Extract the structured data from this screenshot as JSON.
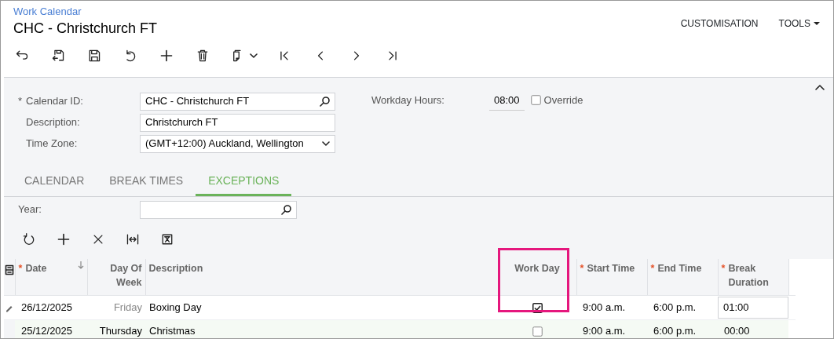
{
  "breadcrumb": "Work Calendar",
  "title": "CHC - Christchurch FT",
  "top_menu": [
    {
      "label": "CUSTOMISATION",
      "dropdown": false
    },
    {
      "label": "TOOLS",
      "dropdown": true
    }
  ],
  "toolbar": [
    {
      "kind": "back"
    },
    {
      "kind": "save-close"
    },
    {
      "kind": "save"
    },
    {
      "kind": "undo"
    },
    {
      "kind": "add"
    },
    {
      "kind": "delete"
    },
    {
      "kind": "copy",
      "dropdown": true
    },
    {
      "kind": "first"
    },
    {
      "kind": "prev"
    },
    {
      "kind": "next"
    },
    {
      "kind": "last"
    }
  ],
  "form": {
    "fields": [
      {
        "marker": "*",
        "label": "Calendar ID:",
        "value": "CHC - Christchurch FT",
        "kind": "lookup"
      },
      {
        "label": "Description:",
        "value": "Christchurch FT",
        "kind": "text"
      },
      {
        "label": "Time Zone:",
        "value": "(GMT+12:00) Auckland, Wellington",
        "kind": "select"
      }
    ],
    "workday_hours": {
      "label": "Workday Hours:",
      "value": "08:00"
    },
    "override": {
      "label": "Override",
      "checked": false
    }
  },
  "tabs": [
    {
      "label": "CALENDAR",
      "selected": false
    },
    {
      "label": "BREAK TIMES",
      "selected": false
    },
    {
      "label": "EXCEPTIONS",
      "selected": true
    }
  ],
  "year_filter": {
    "label": "Year:"
  },
  "grid_toolbar": [
    {
      "kind": "refresh"
    },
    {
      "kind": "add"
    },
    {
      "kind": "delete"
    },
    {
      "kind": "fit"
    },
    {
      "kind": "excel"
    }
  ],
  "table": {
    "columns": [
      {
        "marker": "*",
        "label": "Date",
        "sorted": true,
        "highlighted": false
      },
      {
        "label": "Day Of Week",
        "sorted": false,
        "highlighted": false
      },
      {
        "label": "Description",
        "sorted": false,
        "highlighted": false
      },
      {
        "label": "Work Day",
        "sorted": false,
        "highlighted": true
      },
      {
        "marker": "*",
        "label": "Start Time",
        "sorted": false,
        "highlighted": false
      },
      {
        "marker": "*",
        "label": "End Time",
        "sorted": false,
        "highlighted": false
      },
      {
        "marker": "*",
        "label": "Break Duration",
        "sorted": false,
        "highlighted": false
      }
    ],
    "rows": [
      {
        "selected": true,
        "date": "26/12/2025",
        "day": "Friday",
        "description": "Boxing Day",
        "work_day": true,
        "start": "9:00 a.m.",
        "end": "6:00 p.m.",
        "break": "01:00"
      },
      {
        "selected": false,
        "date": "25/12/2025",
        "day": "Thursday",
        "description": "Christmas",
        "work_day": false,
        "start": "9:00 a.m.",
        "end": "6:00 p.m.",
        "break": "00:00"
      }
    ]
  }
}
